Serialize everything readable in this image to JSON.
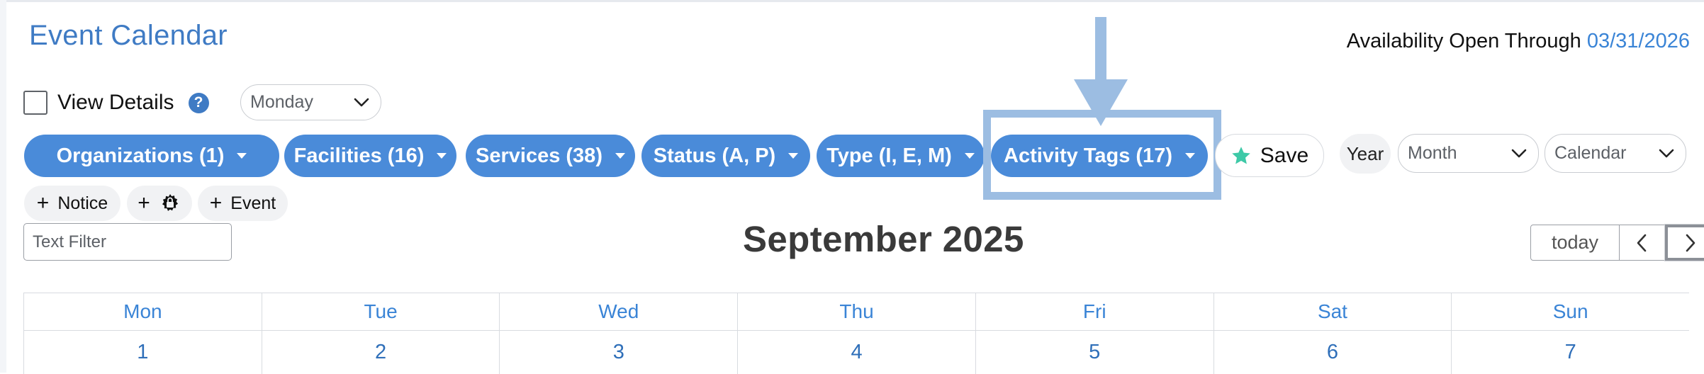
{
  "header": {
    "title": "Event Calendar",
    "availability_label": "Availability Open Through ",
    "availability_date": "03/31/2026"
  },
  "view_details": {
    "label": "View Details",
    "help_icon": "?"
  },
  "week_start_select": {
    "value": "Monday"
  },
  "filters": [
    {
      "label": "Organizations (1)"
    },
    {
      "label": "Facilities (16)"
    },
    {
      "label": "Services (38)"
    },
    {
      "label": "Status (A, P)"
    },
    {
      "label": "Type (I, E, M)"
    },
    {
      "label": "Activity Tags (17)"
    }
  ],
  "save_button": {
    "label": "Save",
    "icon": "star-icon"
  },
  "view_controls": {
    "year_label": "Year",
    "range_select": "Month",
    "mode_select": "Calendar"
  },
  "add_buttons": {
    "notice_label": "Notice",
    "facility_icon": "gear-lock-icon",
    "event_label": "Event"
  },
  "text_filter": {
    "placeholder": "Text Filter",
    "value": ""
  },
  "calendar": {
    "month_title": "September 2025",
    "today_label": "today",
    "weekdays": [
      "Mon",
      "Tue",
      "Wed",
      "Thu",
      "Fri",
      "Sat",
      "Sun"
    ],
    "first_week_days": [
      "1",
      "2",
      "3",
      "4",
      "5",
      "6",
      "7"
    ]
  },
  "annotation": {
    "highlight_color": "#9cbde2",
    "highlighted_item": "Activity Tags (17)"
  },
  "colors": {
    "accent": "#4a8bd9",
    "title": "#3f7bc4",
    "save_star": "#3ec9a7"
  }
}
